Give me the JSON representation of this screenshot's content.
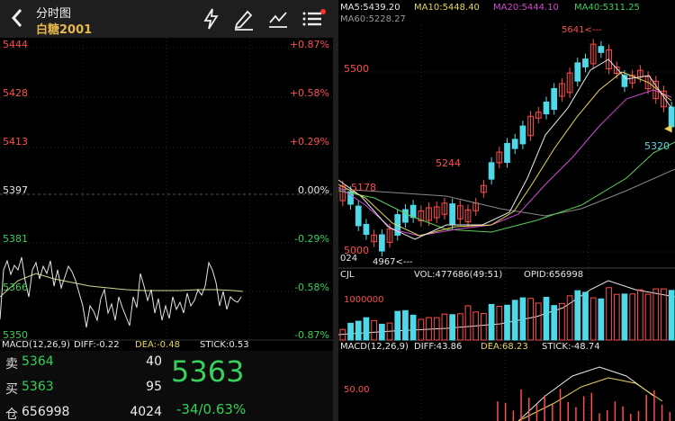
{
  "header": {
    "back_icon": "chevron-left-icon",
    "title": "分时图",
    "subtitle": "白糖2001",
    "icons": [
      "lightning-icon",
      "pen-icon",
      "drawing-icon",
      "menu-icon"
    ]
  },
  "intraday": {
    "price_levels": [
      {
        "price": "5444",
        "pct": "+0.87%",
        "tone": "red"
      },
      {
        "price": "5428",
        "pct": "+0.58%",
        "tone": "red"
      },
      {
        "price": "5413",
        "pct": "+0.29%",
        "tone": "red"
      },
      {
        "price": "5397",
        "pct": "0.00%",
        "tone": "white"
      },
      {
        "price": "5381",
        "pct": "-0.29%",
        "tone": "green"
      },
      {
        "price": "5366",
        "pct": "-0.58%",
        "tone": "green"
      },
      {
        "price": "5350",
        "pct": "-0.87%",
        "tone": "green"
      }
    ],
    "macd_label": "MACD(12,26,9)",
    "diff": "DIFF:-0.22",
    "dea": "DEA:-0.48",
    "stick": "STICK:0.53"
  },
  "orderbook": {
    "sell_label": "卖",
    "sell_price": "5364",
    "sell_qty": "40",
    "buy_label": "买",
    "buy_price": "5363",
    "buy_qty": "95",
    "oi_label": "仓",
    "oi": "656998",
    "vol": "4024",
    "last_price": "5363",
    "change": "-34/0.63%"
  },
  "kline": {
    "ma5": "MA5:5439.20",
    "ma10": "MA10:5448.40",
    "ma20": "MA20:5444.10",
    "ma40": "MA40:5311.25",
    "ma60": "MA60:5228.27",
    "high_annotation": "5641<---",
    "low_annotation": "4967<---",
    "label_5500": "5500",
    "label_5244": "5244",
    "label_5178": "5178",
    "label_5320": "5320",
    "label_5000": "5000",
    "label_024": "024",
    "cjl": "CJL",
    "vol": "VOL:477686(49:51)",
    "opid": "OPID:656998",
    "vol_axis": "1000000",
    "macd_label": "MACD(12,26,9)",
    "diff": "DIFF:43.86",
    "dea": "DEA:68.23",
    "stick": "STICK:-48.74",
    "macd_axis": "50.00"
  },
  "colors": {
    "up": "#ff4d4d",
    "down": "#4fd8e8",
    "price": "#37d05a",
    "accent": "#e6b84a"
  }
}
